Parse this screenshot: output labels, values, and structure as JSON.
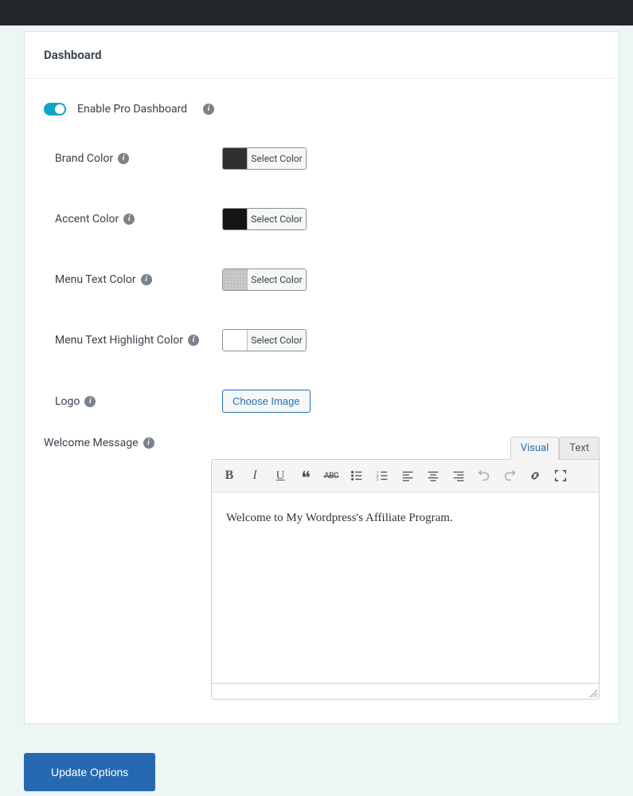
{
  "header": {
    "title": "Dashboard"
  },
  "toggle": {
    "label": "Enable Pro Dashboard"
  },
  "fields": {
    "brand_color": {
      "label": "Brand Color",
      "btn": "Select Color",
      "swatch": "#2a2a2a"
    },
    "accent_color": {
      "label": "Accent Color",
      "btn": "Select Color",
      "swatch": "#151515"
    },
    "menu_text_color": {
      "label": "Menu Text Color",
      "btn": "Select Color",
      "swatch": "#c9c9c9"
    },
    "menu_highlight_color": {
      "label": "Menu Text Highlight Color",
      "btn": "Select Color",
      "swatch": "#ffffff"
    },
    "logo": {
      "label": "Logo",
      "btn": "Choose Image"
    }
  },
  "welcome": {
    "label": "Welcome Message",
    "tabs": {
      "visual": "Visual",
      "text": "Text"
    },
    "content": "Welcome to My Wordpress's Affiliate Program."
  },
  "actions": {
    "update": "Update Options"
  }
}
